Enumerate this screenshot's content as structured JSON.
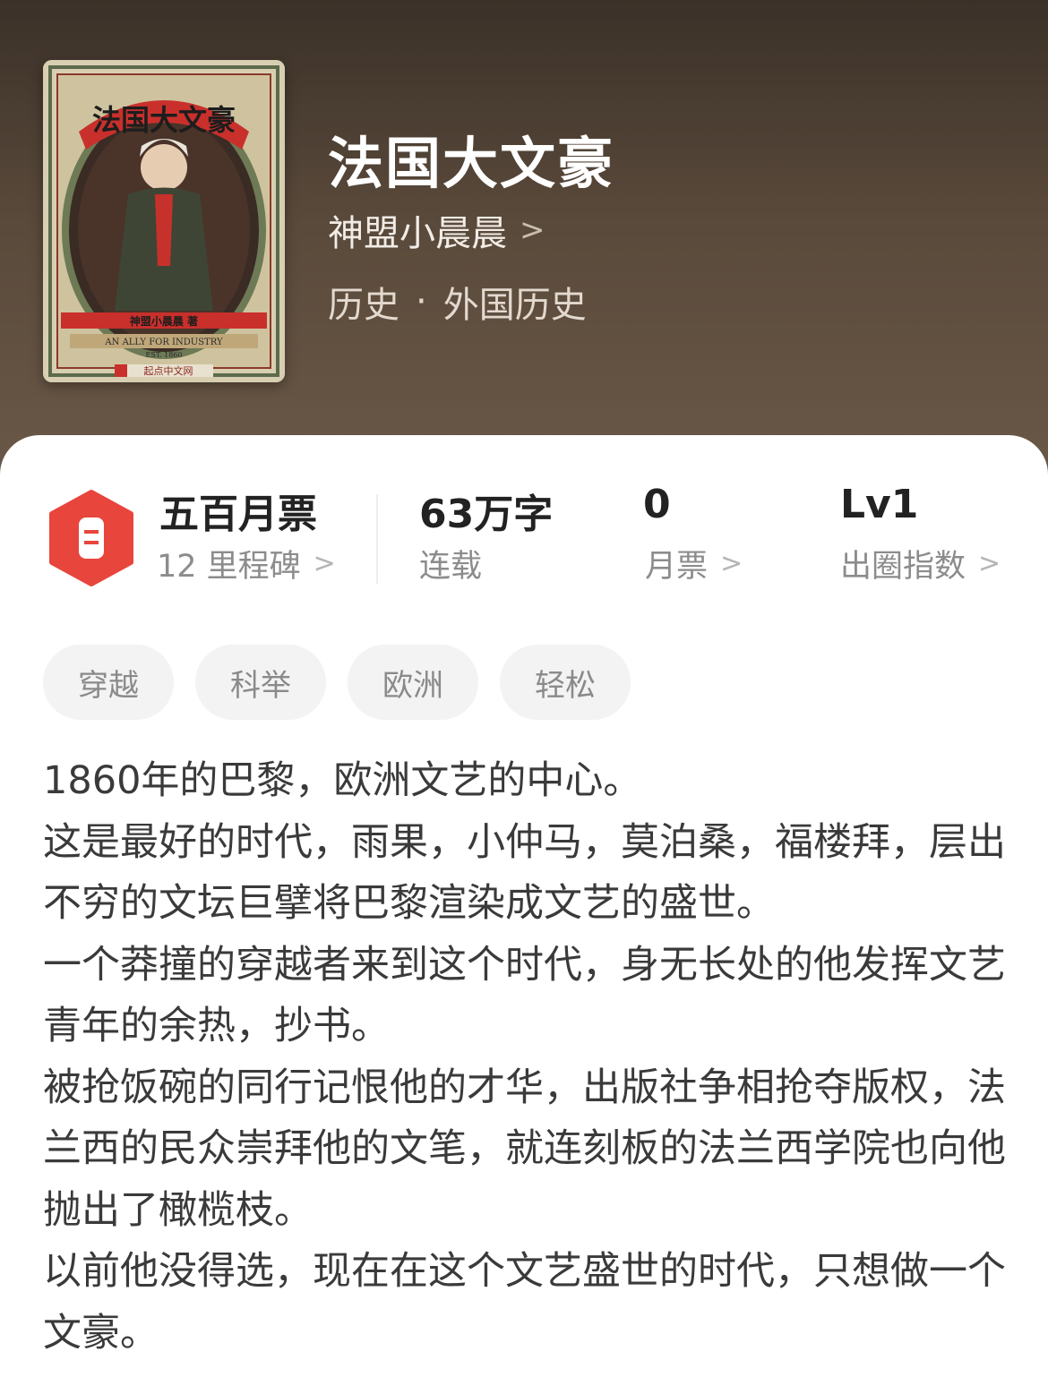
{
  "book": {
    "title": "法国大文豪",
    "author": "神盟小晨晨",
    "author_chevron": ">",
    "category": "历史",
    "separator": "·",
    "subcategory": "外国历史",
    "cover": {
      "title_text": "法国大文豪",
      "author_text": "神盟小晨晨 著",
      "banner_text": "AN ALLY FOR INDUSTRY",
      "est_text": "EST. 1860",
      "publisher_text": "起点中文网"
    }
  },
  "stats": {
    "milestone": {
      "value": "五百月票",
      "label": "12 里程碑",
      "chevron": ">"
    },
    "words": {
      "value": "63万字",
      "label": "连载"
    },
    "tickets": {
      "value": "0",
      "label": "月票",
      "chevron": ">"
    },
    "influence": {
      "value": "Lv1",
      "label": "出圈指数",
      "chevron": ">"
    }
  },
  "tags": [
    "穿越",
    "科举",
    "欧洲",
    "轻松"
  ],
  "synopsis": [
    "1860年的巴黎，欧洲文艺的中心。",
    "这是最好的时代，雨果，小仲马，莫泊桑，福楼拜，层出不穷的文坛巨擘将巴黎渲染成文艺的盛世。",
    "一个莽撞的穿越者来到这个时代，身无长处的他发挥文艺青年的余热，抄书。",
    "被抢饭碗的同行记恨他的才华，出版社争相抢夺版权，法兰西的民众崇拜他的文笔，就连刻板的法兰西学院也向他抛出了橄榄枝。",
    "以前他没得选，现在在这个文艺盛世的时代，只想做一个文豪。"
  ],
  "colors": {
    "hero_top": "#3b3128",
    "hero_bottom": "#6b5948",
    "badge_red": "#e8453c",
    "text_dark": "#222222",
    "text_gray": "#8c8c8c"
  }
}
